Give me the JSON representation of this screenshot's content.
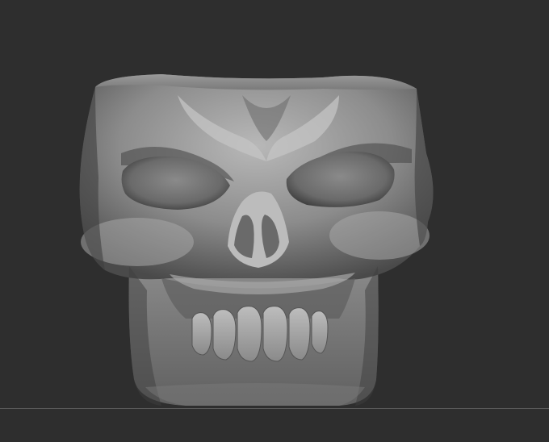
{
  "viewport": {
    "background": "#2e2e2e",
    "floor_line_color": "#5a5a5a"
  },
  "model": {
    "subject": "skull-sculpt",
    "material_base": "#8e8e8e",
    "material_highlight": "#c8c8c8",
    "material_shadow": "#3a3a3a"
  }
}
